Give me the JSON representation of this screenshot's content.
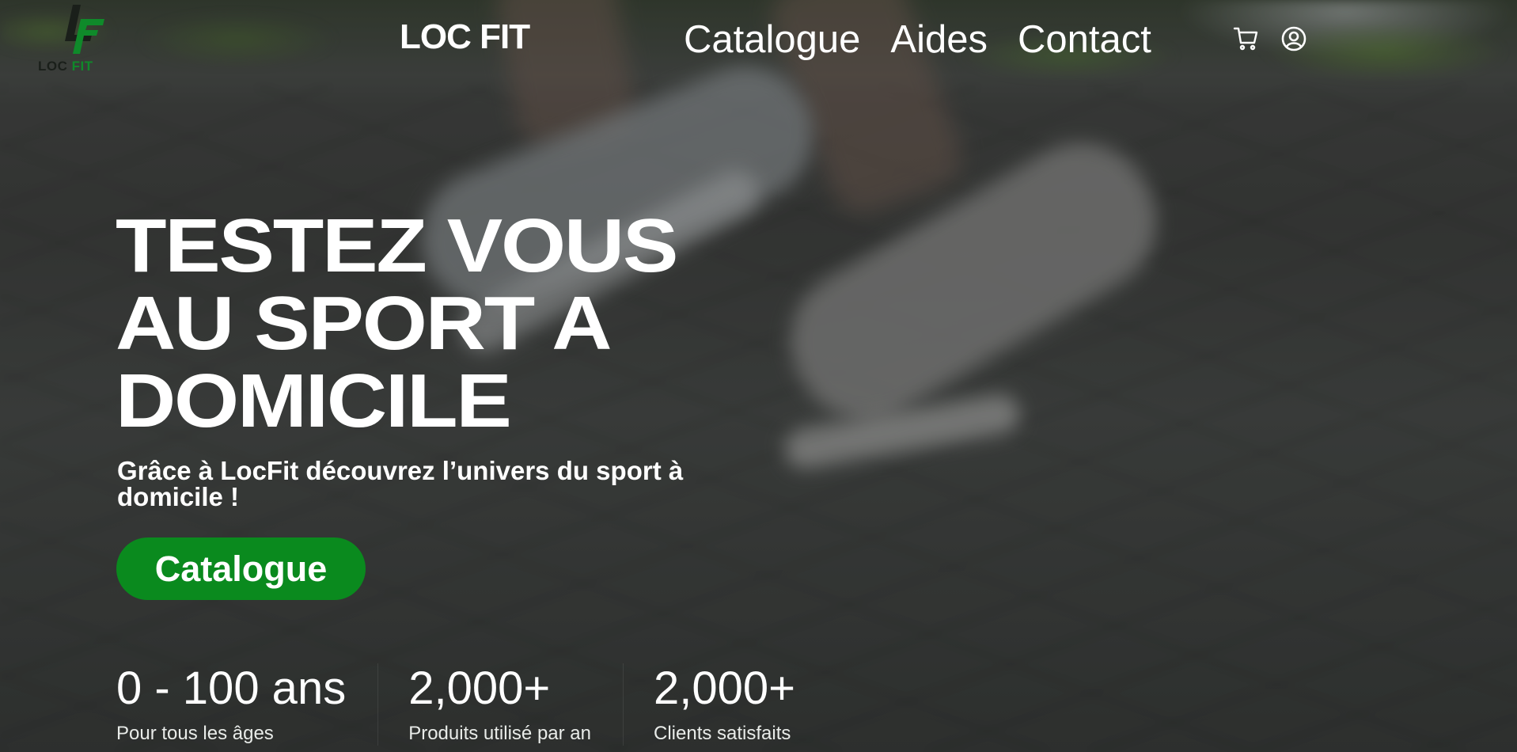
{
  "header": {
    "logo": {
      "mark": "LF",
      "text_loc": "LOC",
      "text_fit": "FIT"
    },
    "brand_name": "LOC FIT",
    "nav": [
      {
        "label": "Catalogue"
      },
      {
        "label": "Aides"
      },
      {
        "label": "Contact"
      }
    ],
    "icons": [
      "cart-icon",
      "user-icon"
    ]
  },
  "hero": {
    "title_lines": [
      "TESTEZ VOUS",
      "AU SPORT A",
      "DOMICILE"
    ],
    "subtitle": "Grâce à LocFit découvrez l’univers du sport à domicile !",
    "cta_label": "Catalogue"
  },
  "stats": [
    {
      "value": "0 - 100 ans",
      "label": "Pour tous les âges"
    },
    {
      "value": "2,000+",
      "label": "Produits utilisé par an"
    },
    {
      "value": "2,000+",
      "label": "Clients satisfaits"
    }
  ],
  "colors": {
    "accent": "#0a8a1e",
    "logo_green": "#0f8a2a",
    "text": "#ffffff"
  }
}
